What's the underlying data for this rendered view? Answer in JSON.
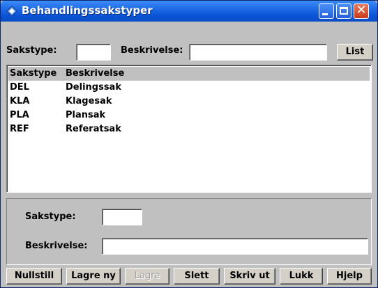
{
  "window": {
    "title": "Behandlingssakstyper",
    "icons": {
      "app": "app-icon",
      "minimize": "minimize-icon",
      "maximize": "maximize-icon",
      "close": "close-icon"
    }
  },
  "search": {
    "sakstype_label": "Sakstype:",
    "sakstype_value": "",
    "beskrivelse_label": "Beskrivelse:",
    "beskrivelse_value": "",
    "list_button": "List"
  },
  "list": {
    "columns": [
      "Sakstype",
      "Beskrivelse"
    ],
    "rows": [
      [
        "DEL",
        "Delingssak"
      ],
      [
        "KLA",
        "Klagesak"
      ],
      [
        "PLA",
        "Plansak"
      ],
      [
        "REF",
        "Referatsak"
      ]
    ]
  },
  "detail": {
    "sakstype_label": "Sakstype:",
    "sakstype_value": "",
    "beskrivelse_label": "Beskrivelse:",
    "beskrivelse_value": ""
  },
  "buttons": {
    "nullstill": "Nullstill",
    "lagre_ny": "Lagre ny",
    "lagre": "Lagre",
    "slett": "Slett",
    "skriv_ut": "Skriv ut",
    "lukk": "Lukk",
    "hjelp": "Hjelp"
  },
  "colors": {
    "titlebar": "#0b55d8",
    "close_button": "#c83a1a",
    "dialog_bg": "#c0c0c0"
  }
}
